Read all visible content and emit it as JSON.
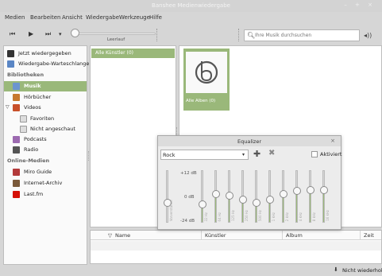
{
  "window": {
    "title": "Banshee Medienwiedergabe",
    "controls": "– + ×"
  },
  "menu": [
    "Medien",
    "Bearbeiten",
    "Ansicht",
    "Wiedergabe",
    "Werkzeuge",
    "Hilfe"
  ],
  "toolbar": {
    "prev": "⏮",
    "play": "▶",
    "next": "⏭",
    "more": "▾",
    "seek_label": "Leerlauf",
    "search_placeholder": "Ihre Musik durchsuchen",
    "volume": "◂))"
  },
  "sidebar": {
    "now_playing": "Jetzt wiedergegeben",
    "queue": "Wiedergabe-Warteschlange",
    "libraries_heading": "Bibliotheken",
    "music": "Musik",
    "audiobooks": "Hörbücher",
    "videos": "Videos",
    "favorites": "Favoriten",
    "unwatched": "Nicht angeschaut",
    "podcasts": "Podcasts",
    "radio": "Radio",
    "online_heading": "Online-Medien",
    "miro": "Miro Guide",
    "archive": "Internet-Archiv",
    "lastfm": "Last.fm"
  },
  "artists": {
    "selected": "Alle Künstler (0)"
  },
  "albums": {
    "tile_caption": "Alle Alben (0)"
  },
  "tracks": {
    "sort_arrow": "▽",
    "columns": [
      "Name",
      "Künstler",
      "Album",
      "Zeit"
    ]
  },
  "status": {
    "repeat": "Nicht wiederholen",
    "arrow": "⬇"
  },
  "equalizer": {
    "title": "Equalizer",
    "close": "×",
    "preset": "Rock",
    "add": "✚",
    "remove": "✖",
    "enabled_label": "Aktiviert",
    "db_high": "+12 dB",
    "db_mid": "0 dB",
    "db_low": "-24 dB",
    "preamp_label": "Vorverstärker",
    "bands": [
      {
        "label": "32 Hz",
        "level": 0.33
      },
      {
        "label": "64 Hz",
        "level": 0.55
      },
      {
        "label": "125 Hz",
        "level": 0.52
      },
      {
        "label": "250 Hz",
        "level": 0.42
      },
      {
        "label": "500 Hz",
        "level": 0.35
      },
      {
        "label": "1 kHz",
        "level": 0.43
      },
      {
        "label": "2 kHz",
        "level": 0.55
      },
      {
        "label": "4 kHz",
        "level": 0.62
      },
      {
        "label": "8 kHz",
        "level": 0.65
      },
      {
        "label": "16 kHz",
        "level": 0.65
      }
    ],
    "preamp_level": 0.35
  },
  "colors": {
    "accent": "#9ab87a"
  }
}
